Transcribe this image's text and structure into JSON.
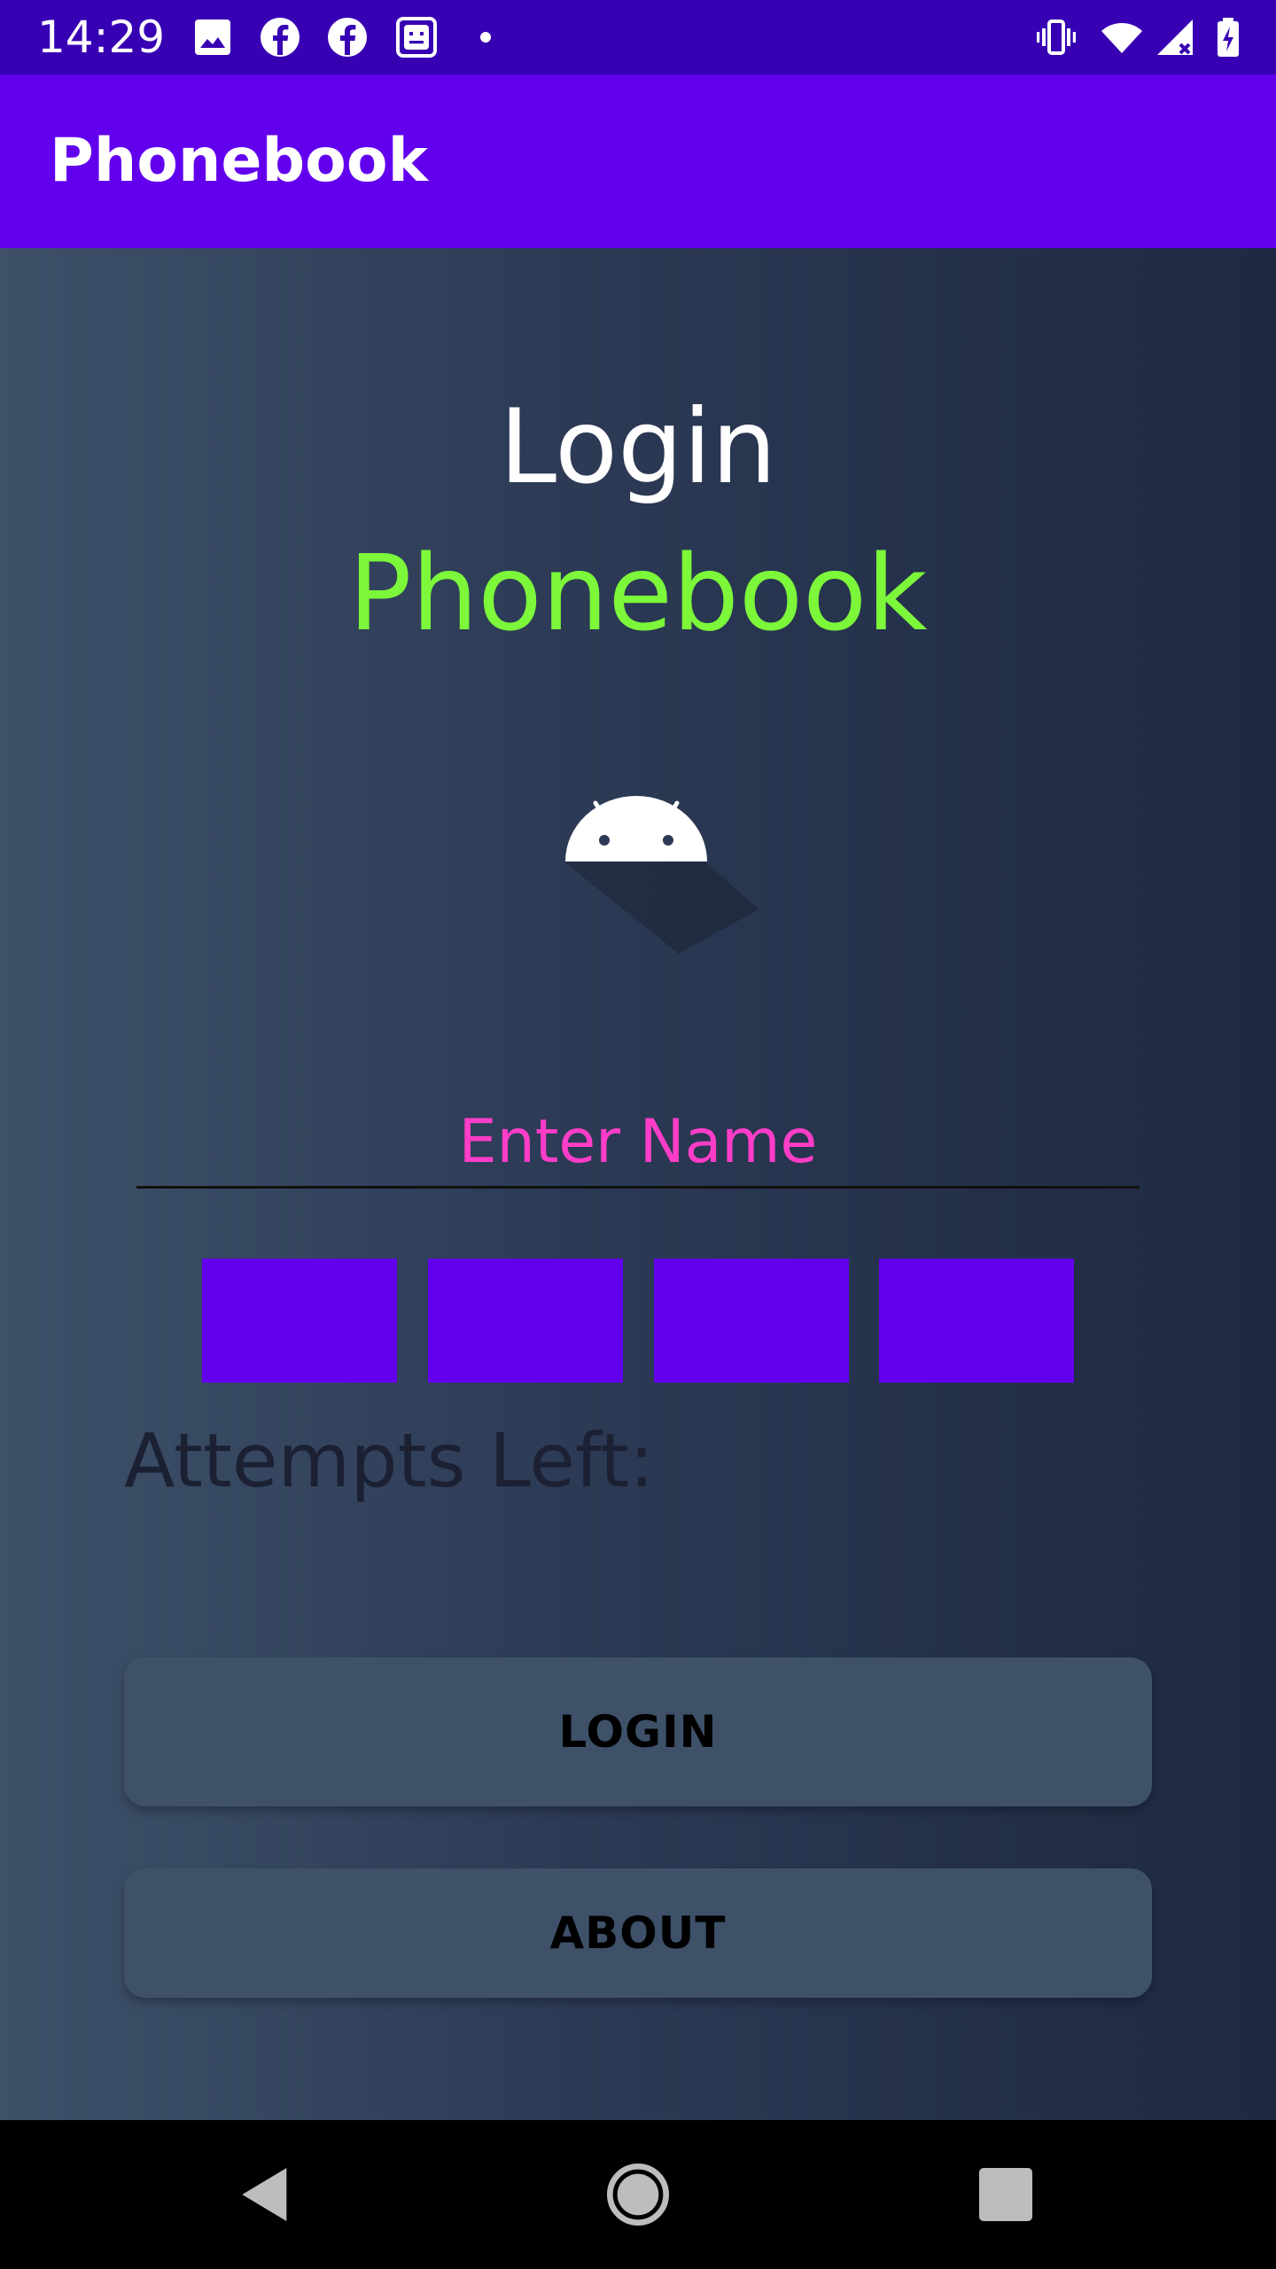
{
  "status_bar": {
    "time": "14:29",
    "icons": [
      "image-icon",
      "facebook-icon",
      "facebook-icon",
      "app-notification-icon",
      "dot-icon",
      "vibrate-icon",
      "wifi-icon",
      "signal-icon",
      "battery-charging-icon"
    ]
  },
  "app_bar": {
    "title": "Phonebook"
  },
  "login": {
    "title": "Login",
    "subtitle": "Phonebook",
    "logo_icon": "android-icon",
    "name_placeholder": "Enter Name",
    "pin_boxes": [
      "",
      "",
      "",
      ""
    ],
    "attempts_label": "Attempts Left:",
    "login_button": "LOGIN",
    "about_button": "ABOUT"
  },
  "colors": {
    "status_bar": "#3700b3",
    "app_bar": "#6200ee",
    "subtitle": "#7cf73a",
    "placeholder": "#ff3dc8",
    "pin_box": "#6200ee",
    "button": "#3e5169"
  },
  "nav_bar": {
    "icons": [
      "back-icon",
      "home-icon",
      "recents-icon"
    ]
  }
}
